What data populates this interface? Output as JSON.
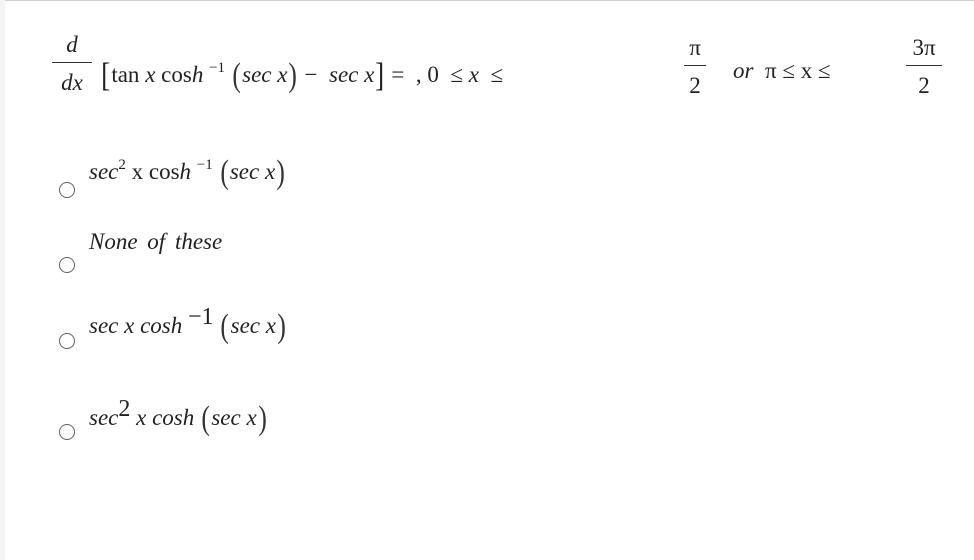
{
  "question": {
    "derivative_numerator": "d",
    "derivative_denominator": "dx",
    "bracket_open": "[",
    "tan": "tan",
    "x1": "x",
    "cosh": "cos",
    "cosh_h": "h",
    "inverse_exp": "−1",
    "paren_open": "(",
    "sec1": "sec x",
    "paren_close": ")",
    "minus": "−",
    "sec2": "sec x",
    "bracket_close": "]",
    "equals": "=",
    "comma": ",",
    "zero": "0",
    "leq1": "≤",
    "x2": "x",
    "leq2": "≤",
    "pi_num": "π",
    "two1": "2",
    "or": "or",
    "pi": "π",
    "leq3": "≤",
    "x3": "x",
    "leq4": "≤",
    "three_pi_num": "3π",
    "two2": "2"
  },
  "options": [
    {
      "id": "a",
      "pre": "sec",
      "sup": "2",
      "mid": "x cos",
      "h": "h",
      "sup2": "−1",
      "arg": "sec x",
      "selected": false
    },
    {
      "id": "b",
      "text": "None of these",
      "selected": false
    },
    {
      "id": "c",
      "pre": "sec x cos",
      "h": "h",
      "sup2": "−1",
      "arg": "sec x",
      "selected": false
    },
    {
      "id": "d",
      "pre": "sec",
      "sup": "2",
      "mid": "x cos",
      "h": "h",
      "arg": "sec x",
      "selected": false
    }
  ]
}
